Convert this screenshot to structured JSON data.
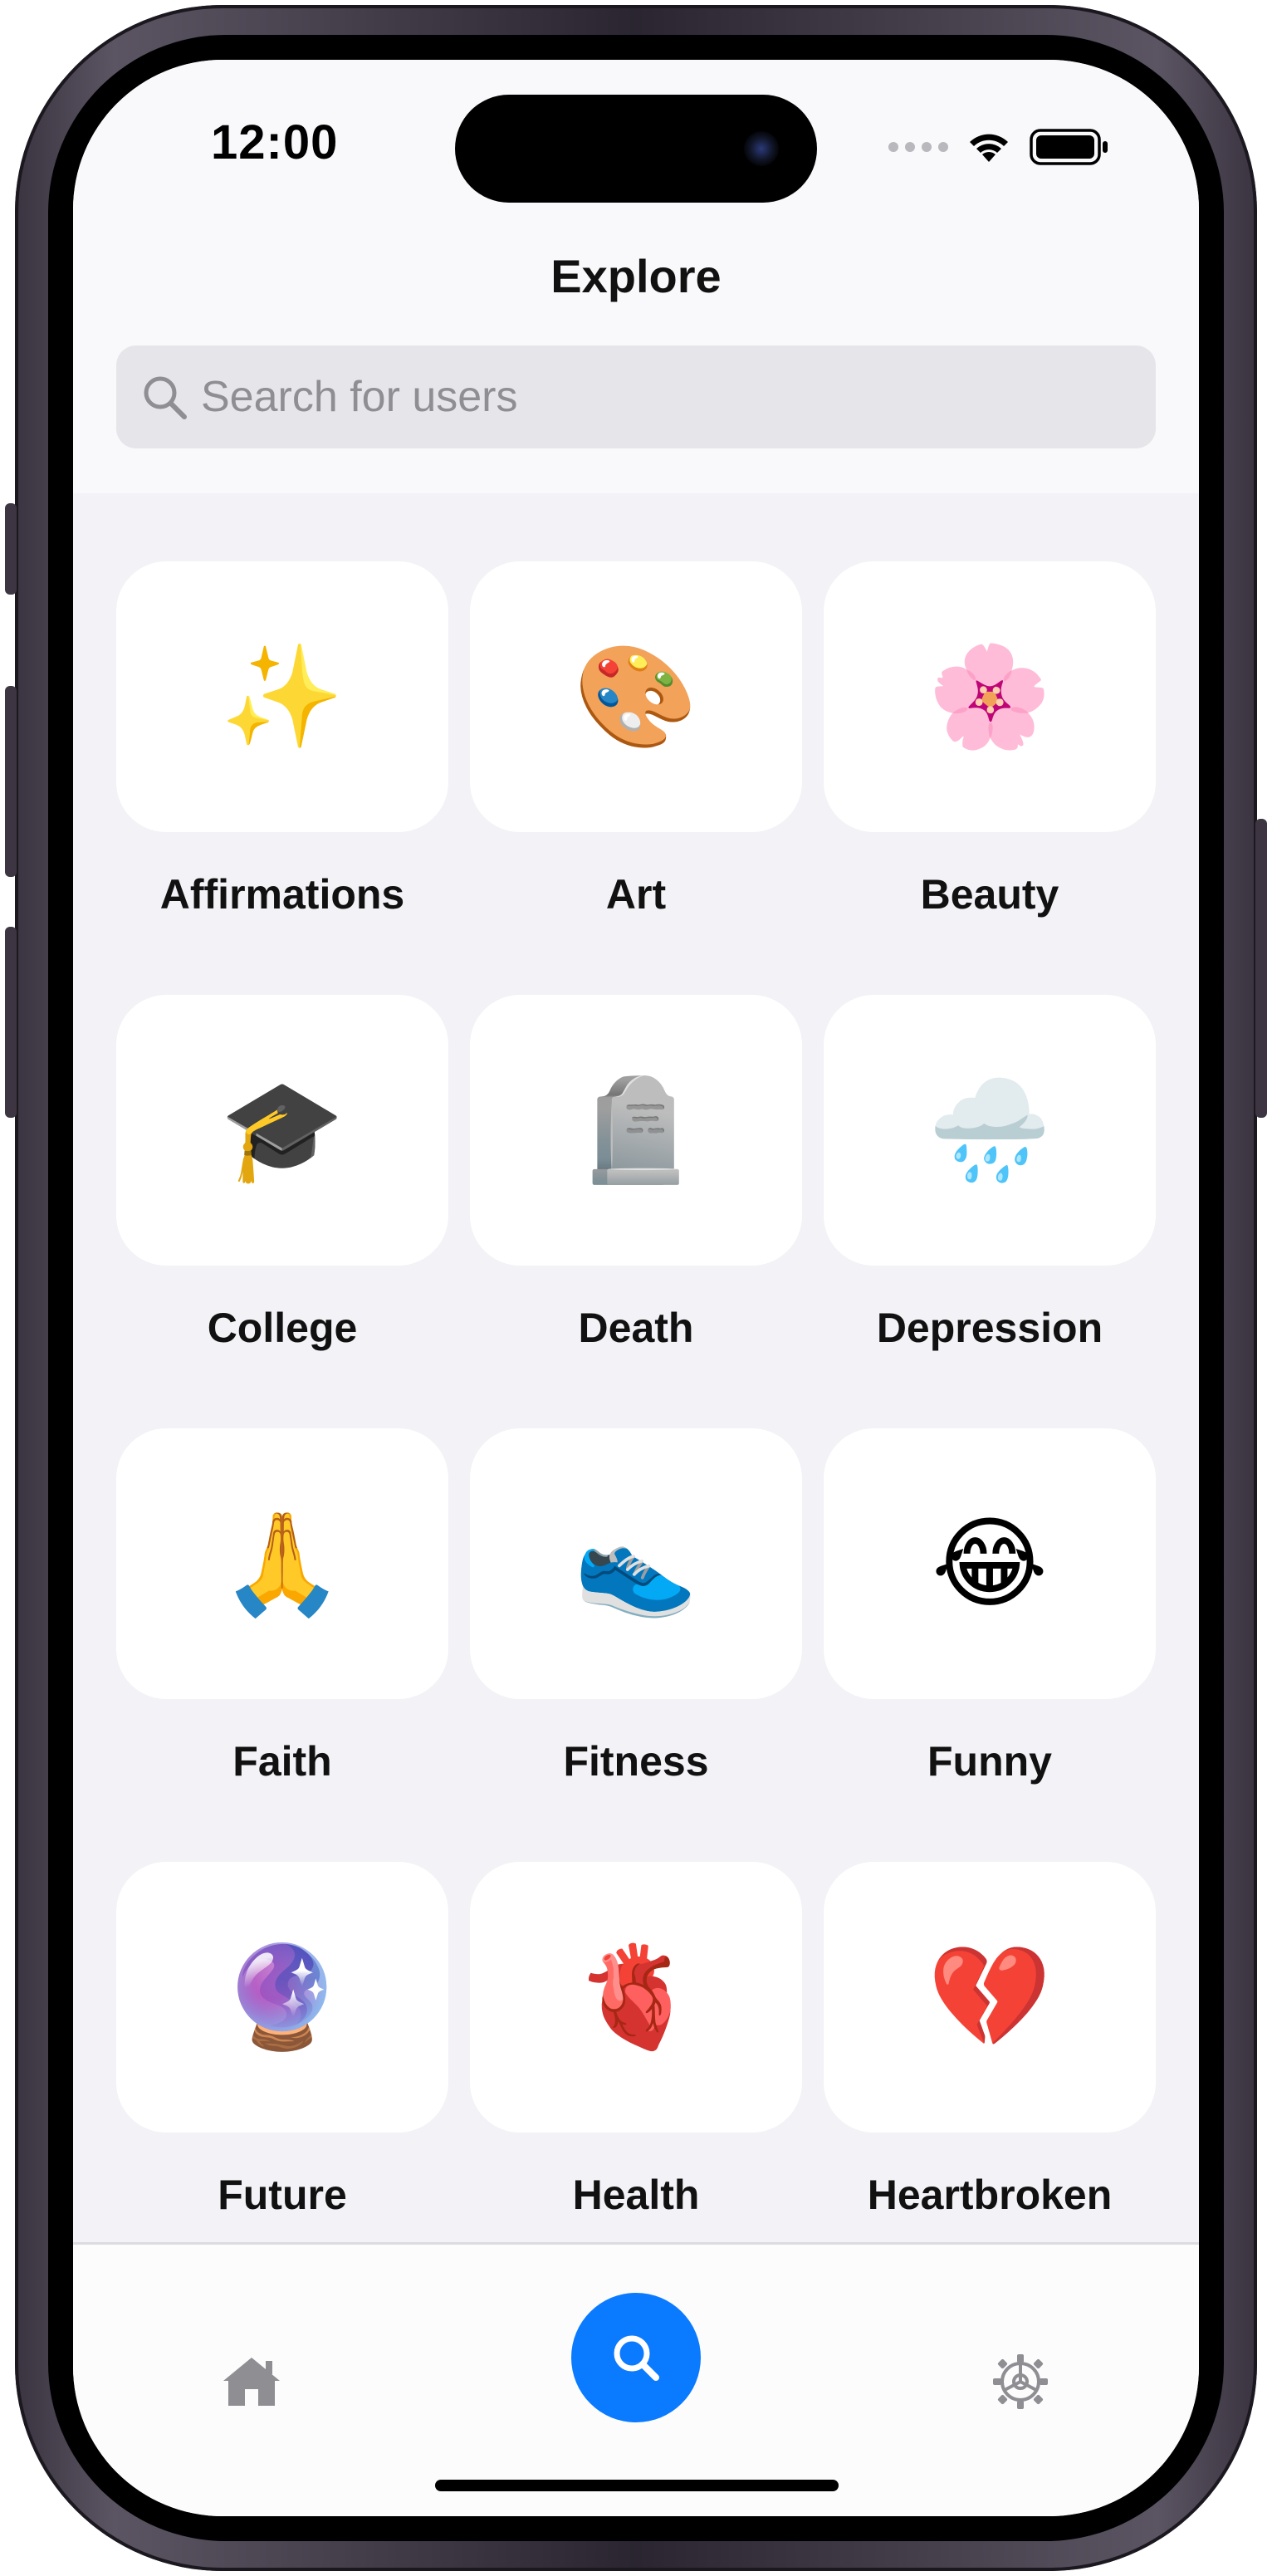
{
  "status_bar": {
    "time": "12:00"
  },
  "header": {
    "title": "Explore"
  },
  "search": {
    "placeholder": "Search for users",
    "value": ""
  },
  "categories": [
    {
      "label": "Affirmations",
      "emoji": "✨",
      "icon": "sparkles-icon"
    },
    {
      "label": "Art",
      "emoji": "🎨",
      "icon": "artist-palette-icon"
    },
    {
      "label": "Beauty",
      "emoji": "🌸",
      "icon": "cherry-blossom-icon"
    },
    {
      "label": "College",
      "emoji": "🎓",
      "icon": "graduation-cap-icon"
    },
    {
      "label": "Death",
      "emoji": "🪦",
      "icon": "headstone-icon"
    },
    {
      "label": "Depression",
      "emoji": "🌧️",
      "icon": "rain-cloud-icon"
    },
    {
      "label": "Faith",
      "emoji": "🙏",
      "icon": "folded-hands-icon"
    },
    {
      "label": "Fitness",
      "emoji": "👟",
      "icon": "running-shoe-icon"
    },
    {
      "label": "Funny",
      "emoji": "😂",
      "icon": "tears-of-joy-icon"
    },
    {
      "label": "Future",
      "emoji": "🔮",
      "icon": "crystal-ball-icon"
    },
    {
      "label": "Health",
      "emoji": "🫀",
      "icon": "anatomical-heart-icon"
    },
    {
      "label": "Heartbroken",
      "emoji": "💔",
      "icon": "broken-heart-icon"
    }
  ],
  "tabbar": {
    "tabs": [
      {
        "name": "home",
        "icon": "home-icon",
        "active": false
      },
      {
        "name": "search",
        "icon": "search-icon",
        "active": true
      },
      {
        "name": "settings",
        "icon": "gear-icon",
        "active": false
      }
    ],
    "active_color": "#0a7aff",
    "inactive_color": "#8e8e93"
  },
  "colors": {
    "accent": "#0a7aff",
    "background": "#f2f2f7",
    "card": "#ffffff"
  }
}
